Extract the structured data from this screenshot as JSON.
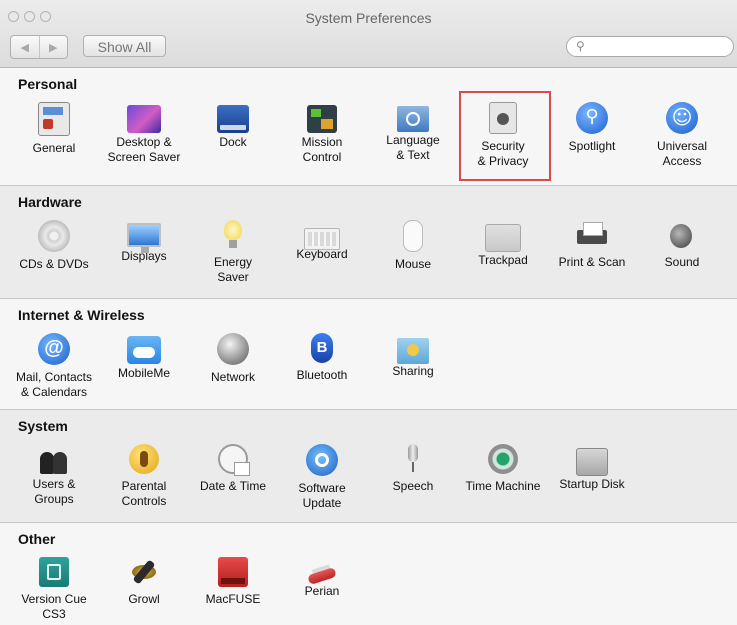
{
  "window": {
    "title": "System Preferences"
  },
  "toolbar": {
    "back": "◀",
    "forward": "▶",
    "show_all": "Show All",
    "search_placeholder": ""
  },
  "colors": {
    "highlight": "#d84b4b"
  },
  "sections": [
    {
      "title": "Personal",
      "items": [
        {
          "label": "General",
          "icon": "general-icon"
        },
        {
          "label": "Desktop &\nScreen Saver",
          "icon": "desktop-screensaver-icon"
        },
        {
          "label": "Dock",
          "icon": "dock-icon"
        },
        {
          "label": "Mission\nControl",
          "icon": "mission-control-icon"
        },
        {
          "label": "Language\n& Text",
          "icon": "language-text-icon"
        },
        {
          "label": "Security\n& Privacy",
          "icon": "security-privacy-icon",
          "highlighted": true
        },
        {
          "label": "Spotlight",
          "icon": "spotlight-icon"
        },
        {
          "label": "Universal\nAccess",
          "icon": "universal-access-icon"
        }
      ]
    },
    {
      "title": "Hardware",
      "items": [
        {
          "label": "CDs & DVDs",
          "icon": "cd-dvd-icon"
        },
        {
          "label": "Displays",
          "icon": "displays-icon"
        },
        {
          "label": "Energy\nSaver",
          "icon": "energy-saver-icon"
        },
        {
          "label": "Keyboard",
          "icon": "keyboard-icon"
        },
        {
          "label": "Mouse",
          "icon": "mouse-icon"
        },
        {
          "label": "Trackpad",
          "icon": "trackpad-icon"
        },
        {
          "label": "Print & Scan",
          "icon": "printer-icon"
        },
        {
          "label": "Sound",
          "icon": "speaker-icon"
        }
      ]
    },
    {
      "title": "Internet & Wireless",
      "items": [
        {
          "label": "Mail, Contacts\n& Calendars",
          "icon": "mail-contacts-icon"
        },
        {
          "label": "MobileMe",
          "icon": "mobileme-icon"
        },
        {
          "label": "Network",
          "icon": "network-icon"
        },
        {
          "label": "Bluetooth",
          "icon": "bluetooth-icon"
        },
        {
          "label": "Sharing",
          "icon": "sharing-icon"
        }
      ]
    },
    {
      "title": "System",
      "items": [
        {
          "label": "Users &\nGroups",
          "icon": "users-groups-icon"
        },
        {
          "label": "Parental\nControls",
          "icon": "parental-controls-icon"
        },
        {
          "label": "Date & Time",
          "icon": "date-time-icon"
        },
        {
          "label": "Software\nUpdate",
          "icon": "software-update-icon"
        },
        {
          "label": "Speech",
          "icon": "microphone-icon"
        },
        {
          "label": "Time Machine",
          "icon": "time-machine-icon"
        },
        {
          "label": "Startup Disk",
          "icon": "startup-disk-icon"
        }
      ]
    },
    {
      "title": "Other",
      "items": [
        {
          "label": "Version Cue\nCS3",
          "icon": "version-cue-icon"
        },
        {
          "label": "Growl",
          "icon": "growl-icon"
        },
        {
          "label": "MacFUSE",
          "icon": "macfuse-icon"
        },
        {
          "label": "Perian",
          "icon": "perian-icon"
        }
      ]
    }
  ]
}
